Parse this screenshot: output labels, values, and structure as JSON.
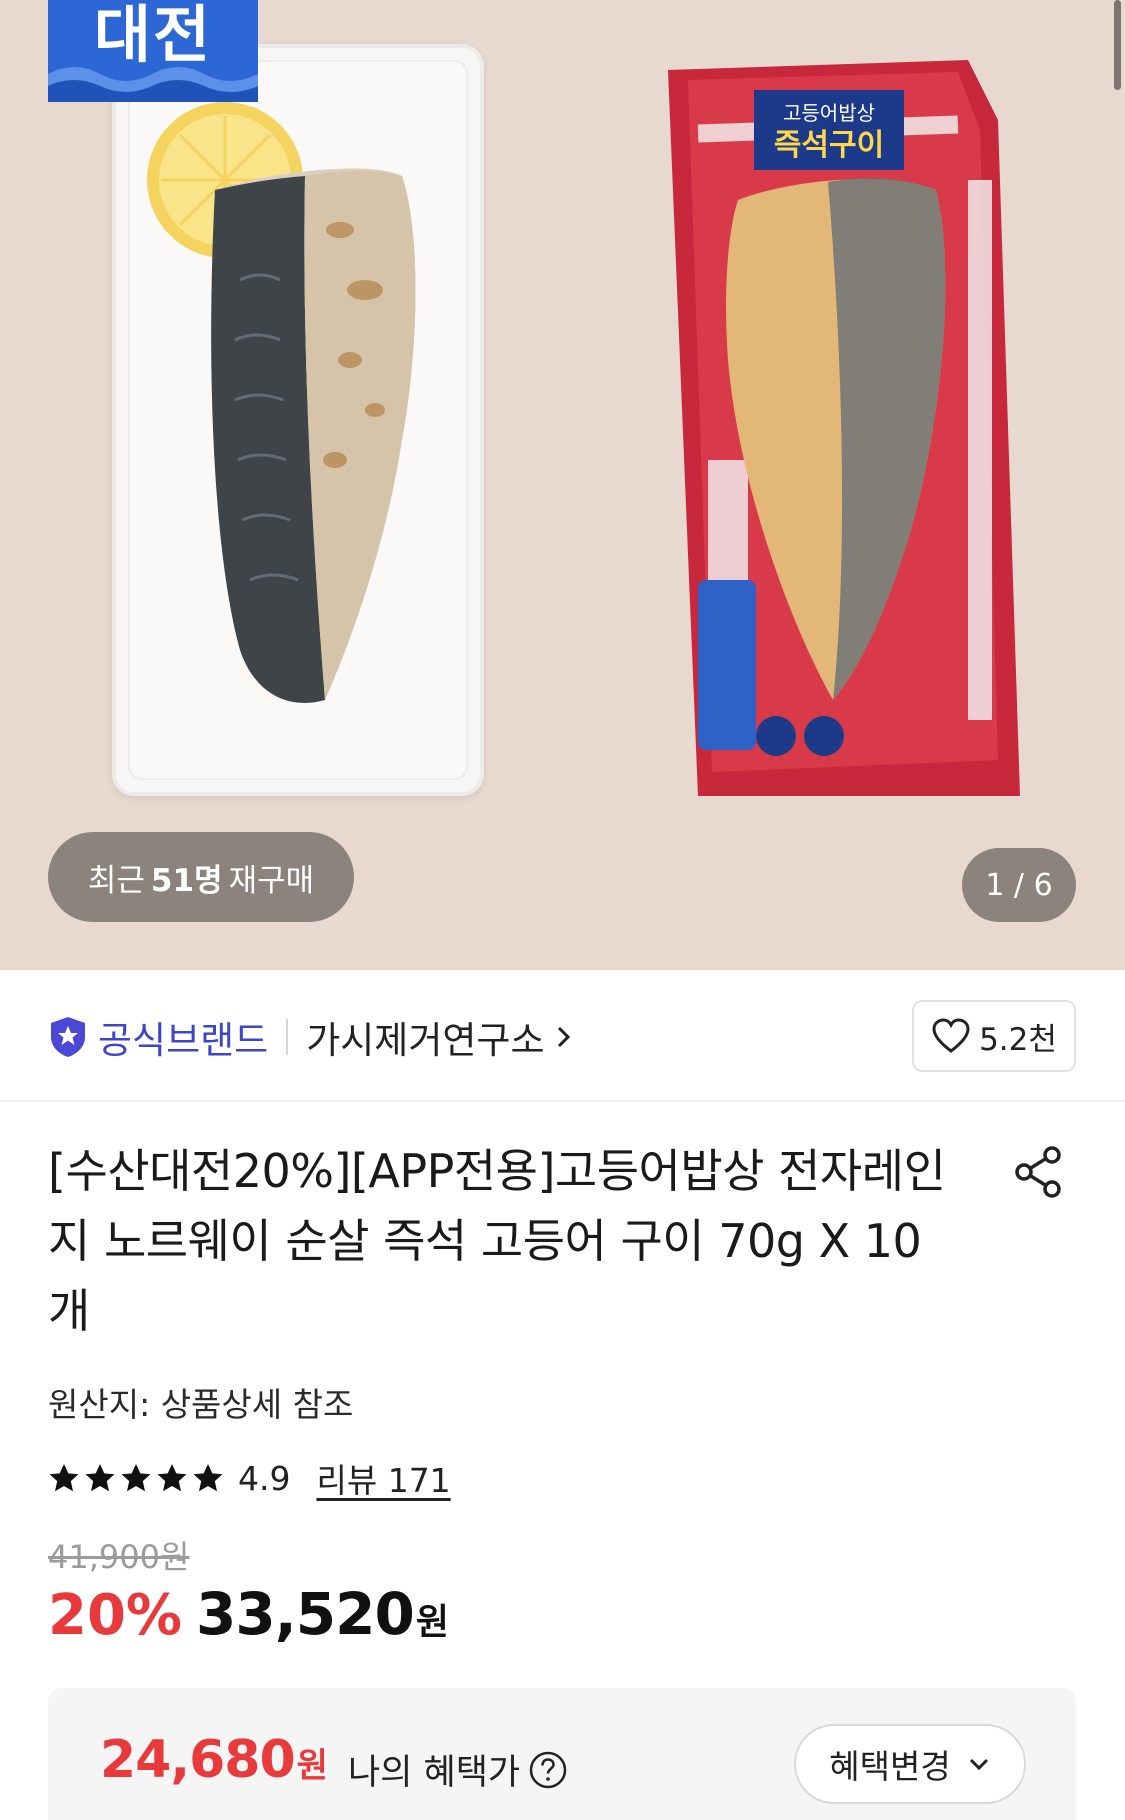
{
  "hero": {
    "event_badge": "대전",
    "repurchase": {
      "prefix": "최근",
      "count": "51명",
      "suffix": "재구매"
    },
    "counter": "1 / 6",
    "pack_label_top": "고등어밥상",
    "pack_label_main": "즉석구이"
  },
  "brand": {
    "official_label": "공식브랜드",
    "name": "가시제거연구소",
    "likes": "5.2천"
  },
  "product": {
    "title": "[수산대전20%][APP전용]고등어밥상 전자레인지 노르웨이 순살 즉석 고등어 구이 70g X 10개",
    "origin": "원산지: 상품상세 참조",
    "rating": "4.9",
    "review": "리뷰 171",
    "original_price": "41,900원",
    "discount": "20%",
    "price": "33,520",
    "price_unit": "원"
  },
  "benefit": {
    "amount": "24,680",
    "unit": "원",
    "label": "나의 혜택가",
    "change_button": "혜택변경"
  },
  "colors": {
    "accent_red": "#e83a3a",
    "brand_blue": "#3d46c8",
    "badge_blue": "#2d67d6"
  },
  "icons": [
    "shield-star-icon",
    "chevron-right-icon",
    "heart-icon",
    "share-icon",
    "star-icon",
    "help-icon",
    "chevron-down-icon"
  ]
}
